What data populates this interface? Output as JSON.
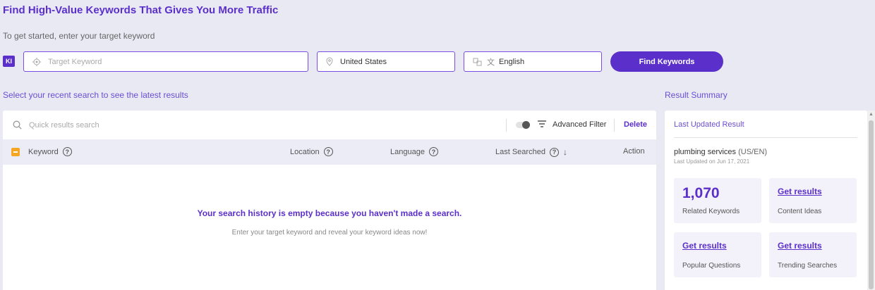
{
  "header": {
    "title": "Find High-Value Keywords That Gives You More Traffic",
    "subtitle": "To get started, enter your target keyword"
  },
  "search_form": {
    "badge": "KI",
    "keyword_placeholder": "Target Keyword",
    "location_value": "United States",
    "language_value": "English",
    "find_button": "Find Keywords"
  },
  "recent": {
    "label": "Select your recent search to see the latest results",
    "quick_search_placeholder": "Quick results search",
    "advanced_filter": "Advanced Filter",
    "delete": "Delete",
    "columns": {
      "keyword": "Keyword",
      "location": "Location",
      "language": "Language",
      "last_searched": "Last Searched",
      "action": "Action"
    },
    "empty_title": "Your search history is empty because you haven't made a search.",
    "empty_subtitle": "Enter your target keyword and reveal your keyword ideas now!"
  },
  "summary": {
    "label": "Result Summary",
    "header": "Last Updated Result",
    "keyword": "plumbing services",
    "keyword_suffix": "(US/EN)",
    "updated": "Last Updated on Jun 17, 2021",
    "cards": [
      {
        "value": "1,070",
        "label": "Related Keywords"
      },
      {
        "value": "Get results",
        "label": "Content Ideas"
      },
      {
        "value": "Get results",
        "label": "Popular Questions"
      },
      {
        "value": "Get results",
        "label": "Trending Searches"
      }
    ]
  },
  "colors": {
    "accent": "#5b2fc9",
    "checkbox": "#f5a623",
    "background": "#e9e9f4"
  }
}
